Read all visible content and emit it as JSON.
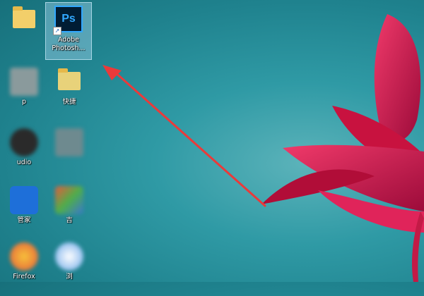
{
  "wallpaper": {
    "accent": "#1f828e",
    "flower": "#d8154a"
  },
  "icons": [
    {
      "label": "",
      "icon": "folder-icon"
    },
    {
      "label": "Adobe Photosh...",
      "icon": "photoshop-icon"
    },
    {
      "label": "p",
      "icon": "app-icon"
    },
    {
      "label": "快捷",
      "icon": "folder-icon"
    },
    {
      "label": "udio",
      "icon": "app-icon"
    },
    {
      "label": "",
      "icon": "app-icon"
    },
    {
      "label": "管家",
      "icon": "shield-icon"
    },
    {
      "label": "吉",
      "icon": "app-icon"
    },
    {
      "label": "Firefox",
      "icon": "firefox-icon"
    },
    {
      "label": "浏",
      "icon": "browser-icon"
    }
  ],
  "arrow": {
    "color": "#ea3a3a"
  }
}
